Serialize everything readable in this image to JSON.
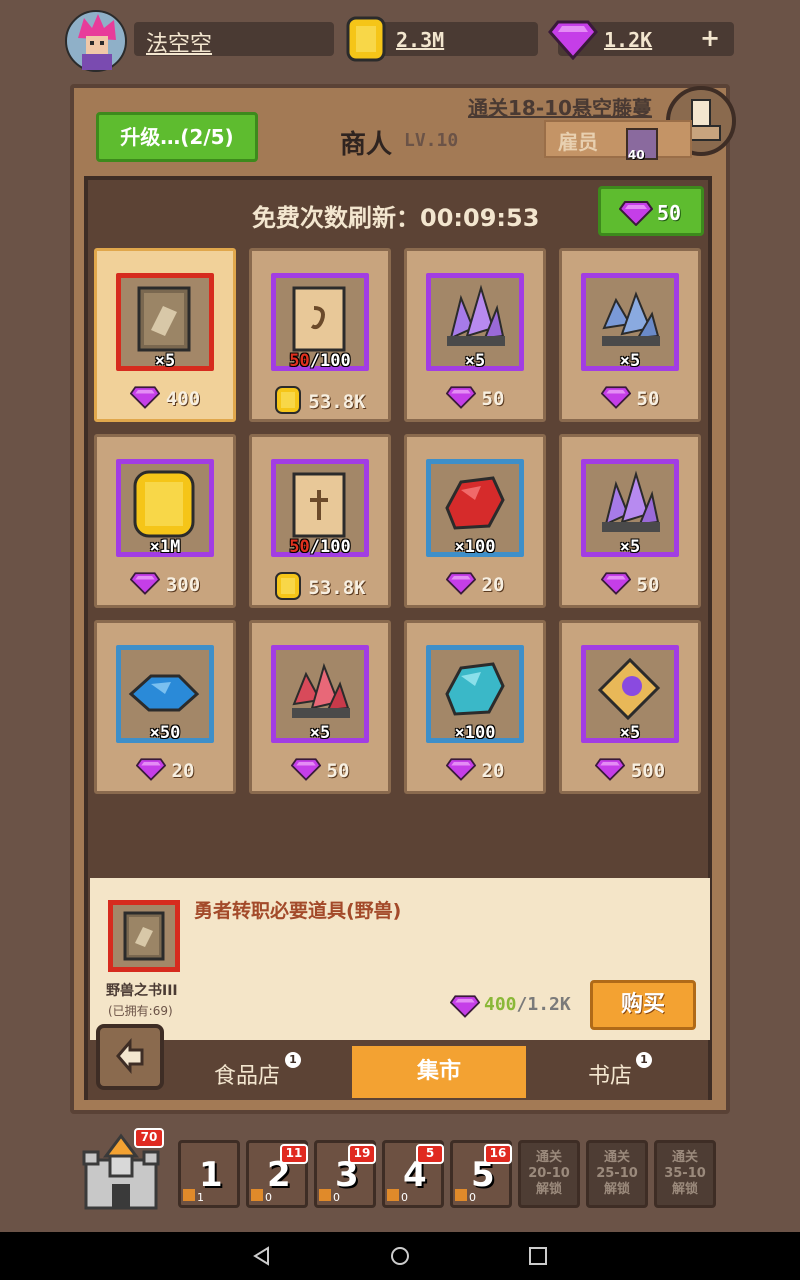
{
  "header": {
    "username": "法空空",
    "gold": "2.3M",
    "gems": "1.2K",
    "add_symbol": "+"
  },
  "banner": {
    "stage_link": "通关18-10悬空藤蔓",
    "upgrade_button": "升级…(2/5)",
    "shop_title": "商人",
    "shop_level": "LV.10",
    "hire_label": "雇员",
    "hire_count": "40"
  },
  "refresh": {
    "label": "免费次数刷新：00:09:53",
    "cost": "50"
  },
  "items": [
    {
      "qty": "×5",
      "price": "400",
      "currency": "gem",
      "frame": "red",
      "icon": "beast-book-icon",
      "selected": true
    },
    {
      "qty_red": "50",
      "qty": "/100",
      "price": "53.8K",
      "currency": "gold",
      "frame": "purple",
      "icon": "scroll-icon"
    },
    {
      "qty": "×5",
      "price": "50",
      "currency": "gem",
      "frame": "purple",
      "icon": "purple-crystal-icon"
    },
    {
      "qty": "×5",
      "price": "50",
      "currency": "gem",
      "frame": "purple",
      "icon": "blue-crystal-icon"
    },
    {
      "qty": "×1M",
      "price": "300",
      "currency": "gem",
      "frame": "purple",
      "icon": "gold-coin-icon"
    },
    {
      "qty_red": "50",
      "qty": "/100",
      "price": "53.8K",
      "currency": "gold",
      "frame": "purple",
      "icon": "dagger-scroll-icon"
    },
    {
      "qty": "×100",
      "price": "20",
      "currency": "gem",
      "frame": "blue",
      "icon": "red-ore-icon"
    },
    {
      "qty": "×5",
      "price": "50",
      "currency": "gem",
      "frame": "purple",
      "icon": "purple-crystal-icon"
    },
    {
      "qty": "×50",
      "price": "20",
      "currency": "gem",
      "frame": "blue",
      "icon": "blue-shard-icon"
    },
    {
      "qty": "×5",
      "price": "50",
      "currency": "gem",
      "frame": "purple",
      "icon": "red-crystal-icon"
    },
    {
      "qty": "×100",
      "price": "20",
      "currency": "gem",
      "frame": "blue",
      "icon": "teal-ore-icon"
    },
    {
      "qty": "×5",
      "price": "500",
      "currency": "gem",
      "frame": "purple",
      "icon": "ticket-icon"
    }
  ],
  "detail": {
    "description": "勇者转职必要道具(野兽)",
    "name": "野兽之书III",
    "owned": "(已拥有:69)",
    "cost": "400",
    "cost_total": "/1.2K",
    "buy_button": "购买"
  },
  "tabs": {
    "food": "食品店",
    "food_badge": "1",
    "market": "集市",
    "book": "书店",
    "book_badge": "1"
  },
  "bottom_nav": {
    "castle_badge": "70",
    "slots": [
      {
        "num": "1",
        "count": "1",
        "badge": ""
      },
      {
        "num": "2",
        "count": "0",
        "badge": "11"
      },
      {
        "num": "3",
        "count": "0",
        "badge": "19"
      },
      {
        "num": "4",
        "count": "0",
        "badge": "5"
      },
      {
        "num": "5",
        "count": "0",
        "badge": "16"
      }
    ],
    "locked": [
      {
        "line1": "通关",
        "line2": "20-10",
        "line3": "解锁"
      },
      {
        "line1": "通关",
        "line2": "25-10",
        "line3": "解锁"
      },
      {
        "line1": "通关",
        "line2": "35-10",
        "line3": "解锁"
      }
    ]
  },
  "colors": {
    "background": "#6b5347",
    "accent_green": "#5ebc2f",
    "accent_orange": "#f3a232",
    "gem_purple": "#c53ee8",
    "gold": "#f5c518"
  }
}
